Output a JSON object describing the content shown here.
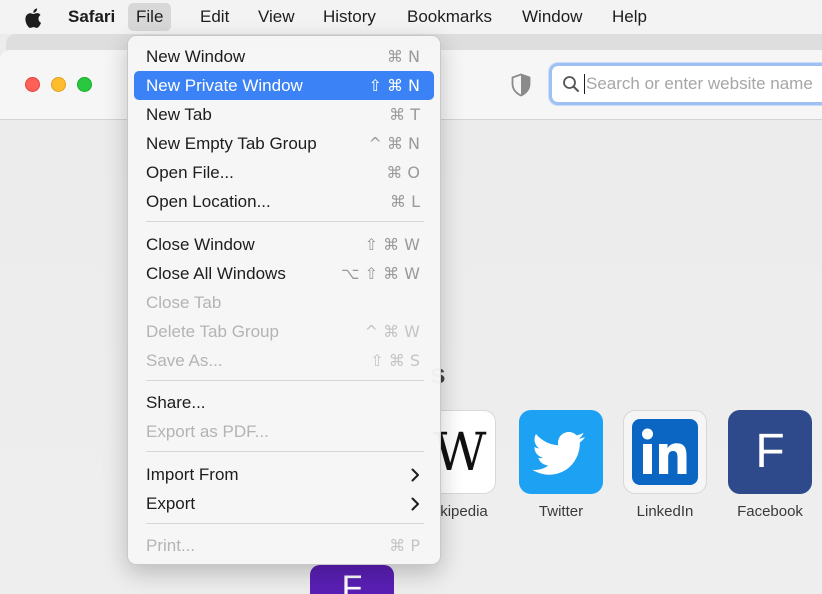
{
  "menubar": {
    "app_name": "Safari",
    "items": [
      "File",
      "Edit",
      "View",
      "History",
      "Bookmarks",
      "Window",
      "Help"
    ]
  },
  "toolbar": {
    "search_placeholder": "Search or enter website name"
  },
  "content": {
    "heading_fragment": "s",
    "tiles": [
      {
        "label": "kipedia",
        "glyph": "W"
      },
      {
        "label": "Twitter"
      },
      {
        "label": "LinkedIn"
      },
      {
        "label": "Facebook",
        "glyph": "F"
      },
      {
        "glyph": "F"
      }
    ]
  },
  "file_menu": {
    "items": [
      {
        "label": "New Window",
        "shortcut": "⌘ N"
      },
      {
        "label": "New Private Window",
        "shortcut": "⇧ ⌘ N",
        "highlighted": true
      },
      {
        "label": "New Tab",
        "shortcut": "⌘ T"
      },
      {
        "label": "New Empty Tab Group",
        "shortcut": "^ ⌘ N"
      },
      {
        "label": "Open File...",
        "shortcut": "⌘ O"
      },
      {
        "label": "Open Location...",
        "shortcut": "⌘ L"
      },
      {
        "label": "Close Window",
        "shortcut": "⇧ ⌘ W"
      },
      {
        "label": "Close All Windows",
        "shortcut": "⌥ ⇧ ⌘ W"
      },
      {
        "label": "Close Tab",
        "shortcut": "",
        "disabled": true
      },
      {
        "label": "Delete Tab Group",
        "shortcut": "^ ⌘ W",
        "disabled": true
      },
      {
        "label": "Save As...",
        "shortcut": "⇧ ⌘ S",
        "disabled": true
      },
      {
        "label": "Share...",
        "shortcut": ""
      },
      {
        "label": "Export as PDF...",
        "shortcut": "",
        "disabled": true
      },
      {
        "label": "Import From",
        "shortcut": "",
        "submenu": true
      },
      {
        "label": "Export",
        "shortcut": "",
        "submenu": true
      },
      {
        "label": "Print...",
        "shortcut": "⌘ P",
        "disabled": true
      }
    ]
  },
  "colors": {
    "highlight": "#3b82f6",
    "twitter": "#1da1f2",
    "linkedin": "#0a66c2",
    "facebook": "#2f4a8a"
  }
}
